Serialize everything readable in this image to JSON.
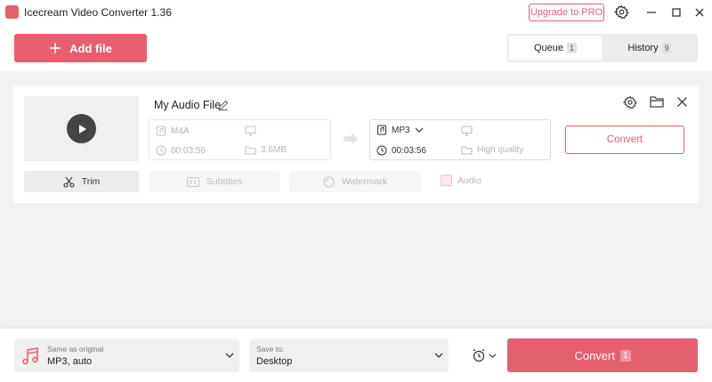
{
  "window": {
    "title": "Icecream Video Converter 1.36",
    "upgrade_label": "Upgrade to PRO"
  },
  "toolbar": {
    "add_file_label": "Add file",
    "tabs": [
      {
        "label": "Queue",
        "count": "1",
        "active": true
      },
      {
        "label": "History",
        "count": "9",
        "active": false
      }
    ]
  },
  "file": {
    "name": "My Audio File",
    "source": {
      "format": "M4A",
      "duration": "00:03:56",
      "size": "3.6MB"
    },
    "target": {
      "format": "MP3",
      "duration": "00:03:56",
      "quality": "High quality"
    },
    "convert_label": "Convert",
    "actions": {
      "trim_label": "Trim",
      "subtitles_label": "Subtitles",
      "watermark_label": "Watermark",
      "audio_label": "Audio"
    }
  },
  "bottom": {
    "format_caption": "Same as original",
    "format_value": "MP3, auto",
    "saveto_caption": "Save to:",
    "saveto_value": "Desktop",
    "convert_label": "Convert",
    "convert_count": "1"
  },
  "colors": {
    "accent": "#e4606d",
    "background": "#f2f2f2"
  }
}
